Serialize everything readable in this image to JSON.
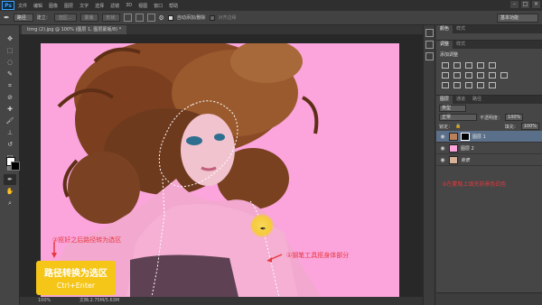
{
  "app": {
    "logo": "Ps"
  },
  "menu": [
    "文件",
    "编辑",
    "图像",
    "图层",
    "文字",
    "选择",
    "滤镜",
    "3D",
    "视图",
    "窗口",
    "帮助"
  ],
  "options_bar": {
    "mode": "路径",
    "make_label": "建立：",
    "selection_btn": "选区...",
    "mask_btn": "蒙版",
    "shape_btn": "形状",
    "auto_add_delete": "自动添加/删除",
    "align_edges": "对齐边缘"
  },
  "workspace": "基本功能",
  "document": {
    "tab_title": "timg (2).jpg @ 100% (图层 1, 图层蒙版/8) *",
    "zoom": "100%",
    "doc_size": "文档:2.75M/5.63M"
  },
  "annotations": {
    "note1": "①钢笔工具抠身体部分",
    "note2": "②抠好之后路径转为选区",
    "note3": "③在蒙版上填充前景色白色",
    "callout_title": "路径转换为选区",
    "callout_shortcut": "Ctrl+Enter"
  },
  "panels": {
    "top_tabs": [
      "颜色",
      "样式"
    ],
    "adjust_tabs": [
      "调整",
      "样式"
    ],
    "adjust_title": "添加调整",
    "layers_tabs": [
      "图层",
      "通道",
      "路径"
    ],
    "kind_filter": "类型",
    "blend_mode": "正常",
    "opacity_label": "不透明度：",
    "opacity_value": "100%",
    "lock_label": "锁定：",
    "fill_label": "填充：",
    "fill_value": "100%",
    "layers": [
      {
        "name": "图层 1",
        "selected": true
      },
      {
        "name": "图层 2",
        "selected": false
      },
      {
        "name": "背景",
        "selected": false
      }
    ]
  },
  "colors": {
    "canvas_pink": "#fba5dc",
    "note_red": "#e8383d",
    "callout_yellow": "#f5c518"
  }
}
